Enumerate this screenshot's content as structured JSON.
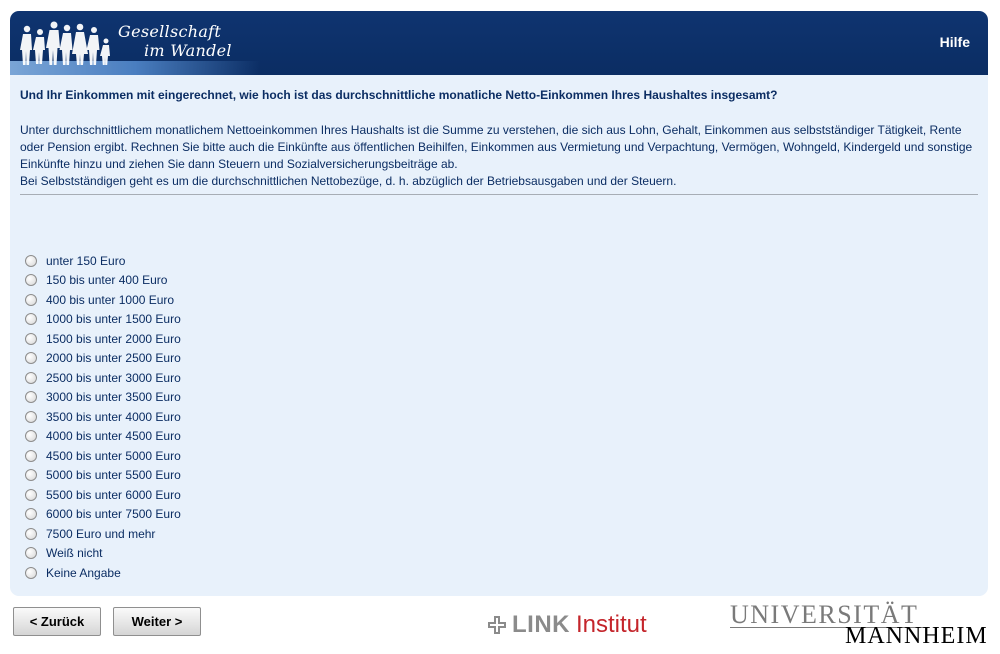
{
  "header": {
    "logo_line1": "Gesellschaft",
    "logo_line2": "im Wandel",
    "help_label": "Hilfe"
  },
  "question": {
    "title": "Und Ihr Einkommen mit eingerechnet, wie hoch ist das durchschnittliche monatliche Netto-Einkommen Ihres Haushaltes insgesamt?",
    "explanation_1": "Unter durchschnittlichem monatlichem Nettoeinkommen Ihres Haushalts ist die Summe zu verstehen, die sich aus Lohn, Gehalt, Einkommen aus selbstständiger Tätigkeit, Rente oder Pension ergibt. Rechnen Sie bitte auch die Einkünfte aus öffentlichen Beihilfen, Einkommen aus Vermietung und Verpachtung, Vermögen, Wohngeld, Kindergeld und sonstige Einkünfte hinzu und ziehen Sie dann Steuern und Sozialversicherungsbeiträge ab.",
    "explanation_2": "Bei Selbstständigen geht es um die durchschnittlichen Nettobezüge, d. h. abzüglich der Betriebsausgaben und der Steuern."
  },
  "options": [
    {
      "label": "unter 150 Euro"
    },
    {
      "label": "150 bis unter 400 Euro"
    },
    {
      "label": "400 bis unter 1000 Euro"
    },
    {
      "label": "1000 bis unter 1500 Euro"
    },
    {
      "label": "1500 bis unter 2000 Euro"
    },
    {
      "label": "2000 bis unter 2500 Euro"
    },
    {
      "label": "2500 bis unter 3000 Euro"
    },
    {
      "label": "3000 bis unter 3500 Euro"
    },
    {
      "label": "3500 bis unter 4000 Euro"
    },
    {
      "label": "4000 bis unter 4500 Euro"
    },
    {
      "label": "4500 bis unter 5000 Euro"
    },
    {
      "label": "5000 bis unter 5500 Euro"
    },
    {
      "label": "5500 bis unter 6000 Euro"
    },
    {
      "label": "6000 bis unter 7500 Euro"
    },
    {
      "label": "7500 Euro und mehr"
    },
    {
      "label": "Weiß nicht"
    },
    {
      "label": "Keine Angabe"
    }
  ],
  "footer": {
    "back_label": "< Zurück",
    "next_label": "Weiter >",
    "link_word": "LINK",
    "link_institut": "Institut",
    "uni_line1": "UNIVERSITÄT",
    "uni_line2": "MANNHEIM"
  },
  "colors": {
    "header_bg": "#0b2d63",
    "panel_bg": "#e8f1fb",
    "text": "#0b2d63",
    "link_red": "#c4252b"
  }
}
